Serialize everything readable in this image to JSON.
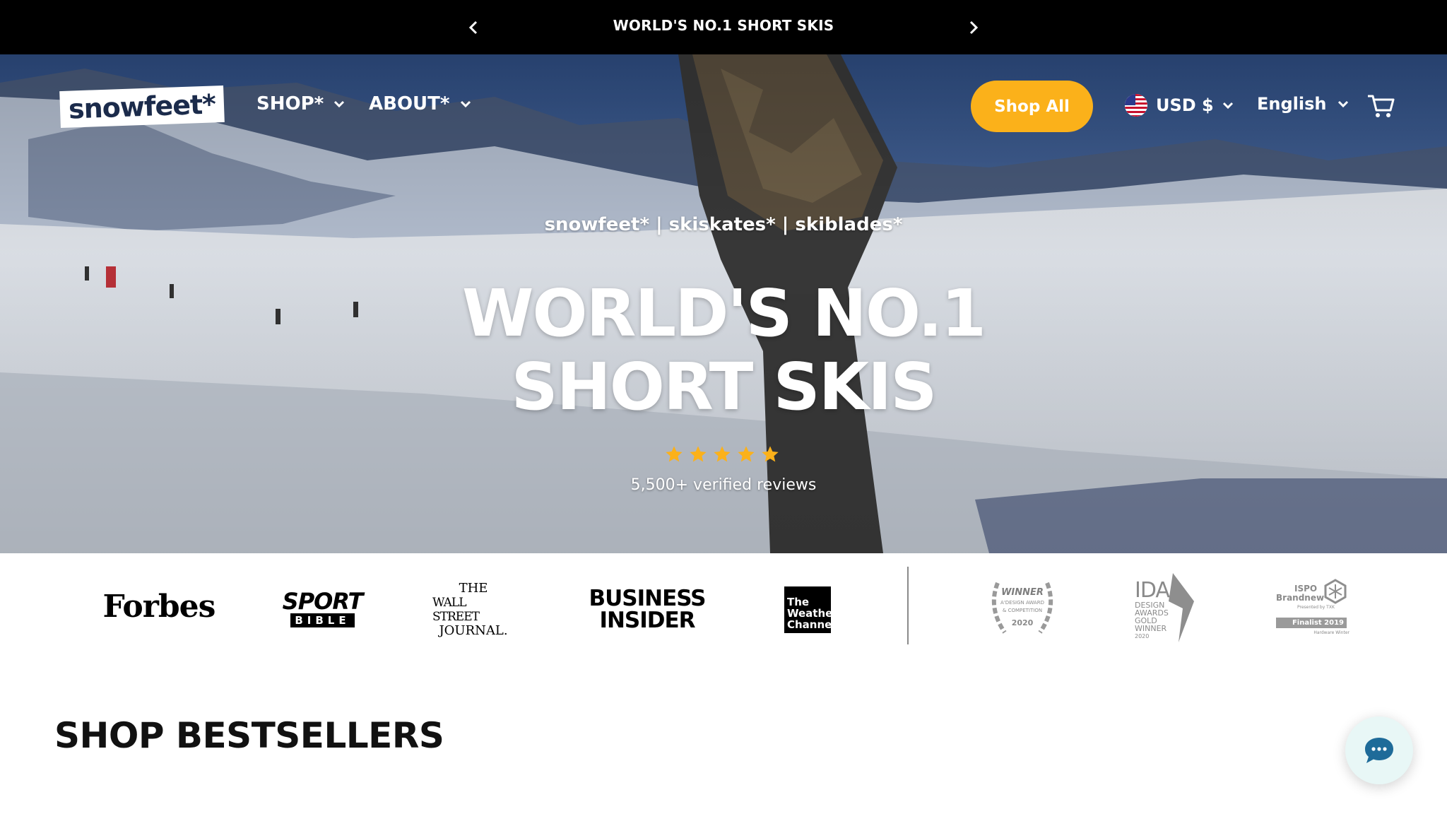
{
  "announcement": {
    "text": "WORLD'S NO.1 SHORT SKIS",
    "prev_icon": "chevron-left-icon",
    "next_icon": "chevron-right-icon"
  },
  "header": {
    "logo_text": "snowfeet*",
    "nav": [
      {
        "label": "SHOP*",
        "icon": "chevron-down-icon"
      },
      {
        "label": "ABOUT*",
        "icon": "chevron-down-icon"
      }
    ],
    "shop_all_label": "Shop All",
    "currency_label": "USD $",
    "currency_flag": "us-flag-icon",
    "language_label": "English",
    "cart_icon": "cart-icon"
  },
  "hero": {
    "subtitle": "snowfeet* | skiskates* | skiblades*",
    "title_line1": "WORLD'S NO.1",
    "title_line2": "SHORT SKIS",
    "rating_stars": 5,
    "reviews_text": "5,500+ verified reviews"
  },
  "press_logos": {
    "forbes": "Forbes",
    "sport_bible_top": "SPORT",
    "sport_bible_bottom": "BIBLE",
    "wsj_line1": "THE",
    "wsj_line2": "WALL STREET",
    "wsj_line3": "JOURNAL.",
    "business_insider_line1": "BUSINESS",
    "business_insider_line2": "INSIDER",
    "weather_line1": "The",
    "weather_line2": "Weather",
    "weather_line3": "Channel"
  },
  "awards": {
    "winner_title": "WINNER",
    "winner_sub1": "A'DESIGN AWARD",
    "winner_sub2": "& COMPETITION",
    "winner_year": "2020",
    "ida_title": "IDA",
    "ida_line1": "DESIGN",
    "ida_line2": "AWARDS",
    "ida_line3": "GOLD",
    "ida_line4": "WINNER",
    "ida_year": "2020",
    "ispo_line1": "ISPO",
    "ispo_line2": "Brandnew",
    "ispo_line3": "Presented by TXK",
    "ispo_finalist": "Finalist 2019",
    "ispo_category": "Hardware Winter"
  },
  "section_title": "SHOP BESTSELLERS",
  "chat_icon": "chat-bubble-icon",
  "colors": {
    "accent": "#fbb11a",
    "announcement_bg": "#000000",
    "logo_text": "#1b2b4b",
    "star": "#fbb11a",
    "chat_bg": "#e8f7f6",
    "chat_icon": "#1e6b99"
  }
}
